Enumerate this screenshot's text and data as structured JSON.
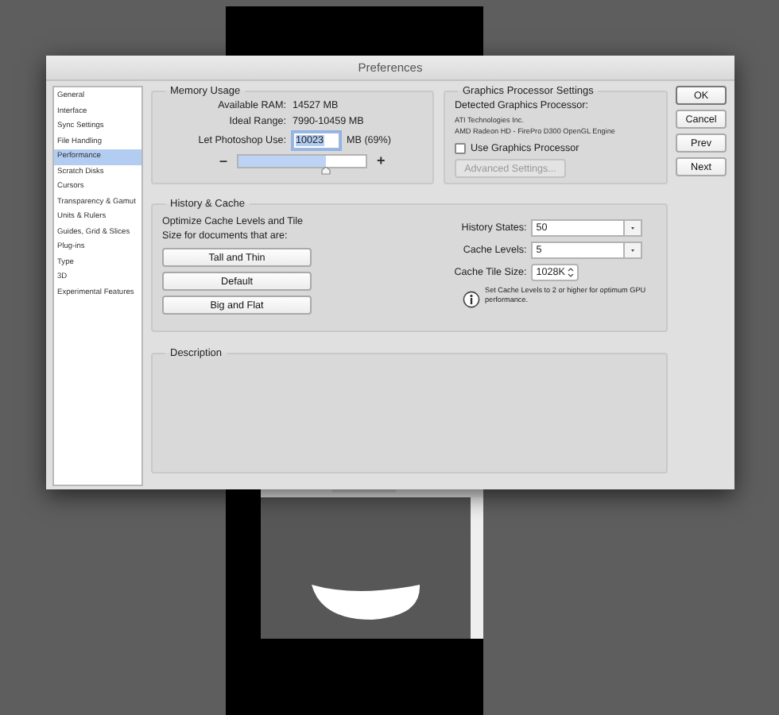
{
  "window": {
    "title": "Preferences"
  },
  "sidebar": {
    "items": [
      {
        "label": "General",
        "selected": false
      },
      {
        "label": "Interface",
        "selected": false
      },
      {
        "label": "Sync Settings",
        "selected": false
      },
      {
        "label": "File Handling",
        "selected": false
      },
      {
        "label": "Performance",
        "selected": true
      },
      {
        "label": "Scratch Disks",
        "selected": false
      },
      {
        "label": "Cursors",
        "selected": false
      },
      {
        "label": "Transparency & Gamut",
        "selected": false
      },
      {
        "label": "Units & Rulers",
        "selected": false
      },
      {
        "label": "Guides, Grid & Slices",
        "selected": false
      },
      {
        "label": "Plug-ins",
        "selected": false
      },
      {
        "label": "Type",
        "selected": false
      },
      {
        "label": "3D",
        "selected": false
      },
      {
        "label": "Experimental Features",
        "selected": false
      }
    ]
  },
  "memory_usage": {
    "title": "Memory Usage",
    "rows": [
      {
        "label": "Available RAM:",
        "value": "14527 MB"
      },
      {
        "label": "Ideal Range:",
        "value": "7990-10459 MB"
      }
    ],
    "use_label": "Let Photoshop Use:",
    "use_value": "10023",
    "use_unit": "MB (69%)",
    "minus": "–",
    "plus": "+",
    "level": 0.69
  },
  "graphics": {
    "title": "Graphics Processor Settings",
    "detected_label": "Detected Graphics Processor:",
    "gpu_lines": [
      "ATI Technologies Inc.",
      "AMD Radeon HD - FirePro D300 OpenGL Engine"
    ],
    "use_gpu": {
      "label": "Use Graphics Processor",
      "checked": false
    },
    "advanced": {
      "label": "Advanced Settings...",
      "disabled": true
    }
  },
  "history_cache": {
    "title": "History & Cache",
    "intro": "Optimize Cache Levels and Tile Size for documents that are:",
    "presets": [
      "Tall and Thin",
      "Default",
      "Big and Flat"
    ],
    "fields": [
      {
        "label": "History States:",
        "value": "50",
        "kind": "combo"
      },
      {
        "label": "Cache Levels:",
        "value": "5",
        "kind": "combo"
      },
      {
        "label": "Cache Tile Size:",
        "value": "1028K",
        "kind": "popup"
      }
    ],
    "note": "Set Cache Levels to 2 or higher for optimum GPU performance."
  },
  "description": {
    "title": "Description"
  },
  "buttons": [
    "OK",
    "Cancel",
    "Prev",
    "Next"
  ]
}
